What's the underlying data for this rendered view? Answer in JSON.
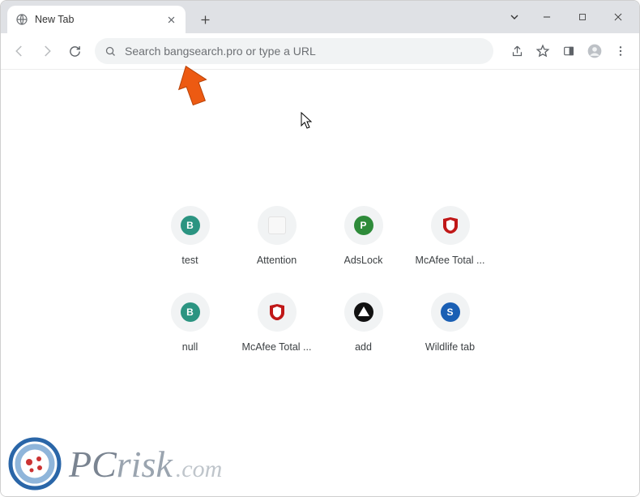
{
  "window": {
    "tab_title": "New Tab"
  },
  "toolbar": {
    "omnibox_placeholder": "Search bangsearch.pro or type a URL"
  },
  "shortcuts": [
    {
      "label": "test",
      "kind": "letter",
      "letter": "B",
      "bg": "#2b9481"
    },
    {
      "label": "Attention",
      "kind": "square"
    },
    {
      "label": "AdsLock",
      "kind": "letter",
      "letter": "P",
      "bg": "#2e8b3a"
    },
    {
      "label": "McAfee Total ...",
      "kind": "mcafee"
    },
    {
      "label": "null",
      "kind": "letter",
      "letter": "B",
      "bg": "#2b9481"
    },
    {
      "label": "McAfee Total ...",
      "kind": "mcafee"
    },
    {
      "label": "add",
      "kind": "triangle"
    },
    {
      "label": "Wildlife tab",
      "kind": "letter",
      "letter": "S",
      "bg": "#1a5fb4"
    }
  ],
  "watermark": {
    "pc": "PC",
    "risk": "risk",
    "com": ".com"
  },
  "colors": {
    "mcafee_red": "#c01818",
    "tabstrip_bg": "#dfe1e5",
    "omnibox_bg": "#f1f3f4",
    "callout_orange": "#ed5a12"
  }
}
